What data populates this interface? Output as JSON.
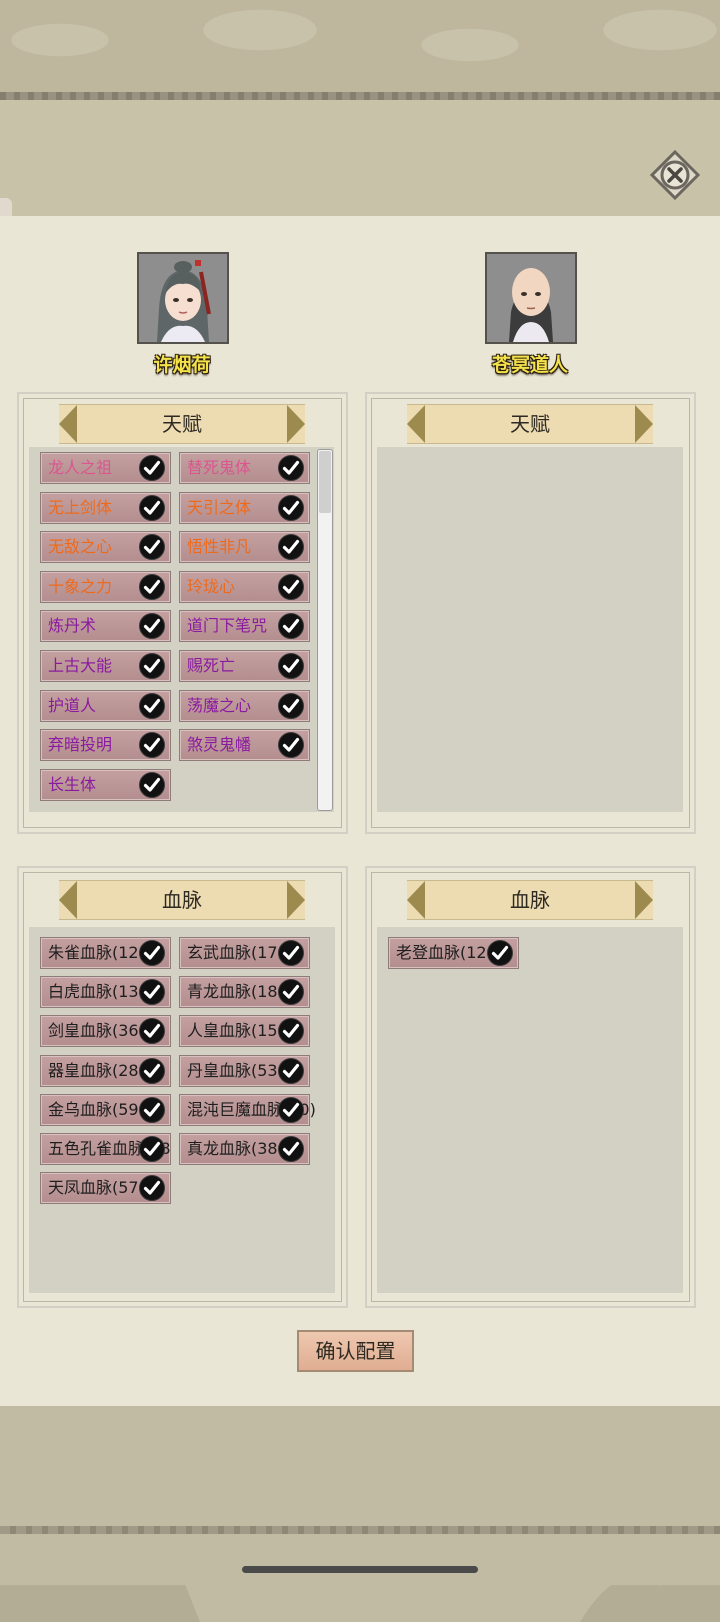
{
  "characters": {
    "left": {
      "name": "许烟荷"
    },
    "right": {
      "name": "苍冥道人"
    }
  },
  "sections": {
    "talent_title": "天赋",
    "bloodline_title": "血脉"
  },
  "left_talents": [
    {
      "label": "龙人之祖",
      "color": "#d9568f"
    },
    {
      "label": "替死鬼体",
      "color": "#d9568f"
    },
    {
      "label": "无上剑体",
      "color": "#ee6a1b"
    },
    {
      "label": "天引之体",
      "color": "#ee6a1b"
    },
    {
      "label": "无敌之心",
      "color": "#ee6a1b"
    },
    {
      "label": "悟性非凡",
      "color": "#ee6a1b"
    },
    {
      "label": "十象之力",
      "color": "#ee6a1b"
    },
    {
      "label": "玲珑心",
      "color": "#ee6a1b"
    },
    {
      "label": "炼丹术",
      "color": "#8a1aa0"
    },
    {
      "label": "道门下笔咒",
      "color": "#8a1aa0"
    },
    {
      "label": "上古大能",
      "color": "#8a1aa0"
    },
    {
      "label": "赐死亡",
      "color": "#8a1aa0"
    },
    {
      "label": "护道人",
      "color": "#8a1aa0"
    },
    {
      "label": "荡魔之心",
      "color": "#8a1aa0"
    },
    {
      "label": "弃暗投明",
      "color": "#8a1aa0"
    },
    {
      "label": "煞灵鬼幡",
      "color": "#8a1aa0"
    },
    {
      "label": "长生体",
      "color": "#8a1aa0"
    }
  ],
  "left_bloodlines": [
    {
      "label": "朱雀血脉(12",
      "color": "#1e1e1e"
    },
    {
      "label": "玄武血脉(17",
      "color": "#1e1e1e"
    },
    {
      "label": "白虎血脉(13",
      "color": "#1e1e1e"
    },
    {
      "label": "青龙血脉(18",
      "color": "#1e1e1e"
    },
    {
      "label": "剑皇血脉(36",
      "color": "#1e1e1e"
    },
    {
      "label": "人皇血脉(15",
      "color": "#1e1e1e"
    },
    {
      "label": "器皇血脉(28",
      "color": "#1e1e1e"
    },
    {
      "label": "丹皇血脉(53",
      "color": "#1e1e1e"
    },
    {
      "label": "金乌血脉(59",
      "color": "#1e1e1e"
    },
    {
      "label": "混沌巨魔血脉(60)",
      "color": "#1e1e1e"
    },
    {
      "label": "五色孔雀血脉(68",
      "color": "#1e1e1e"
    },
    {
      "label": "真龙血脉(38",
      "color": "#1e1e1e"
    },
    {
      "label": "天凤血脉(57",
      "color": "#1e1e1e"
    }
  ],
  "right_bloodlines": [
    {
      "label": "老登血脉(12",
      "color": "#1e1e1e"
    }
  ],
  "confirm_label": "确认配置"
}
